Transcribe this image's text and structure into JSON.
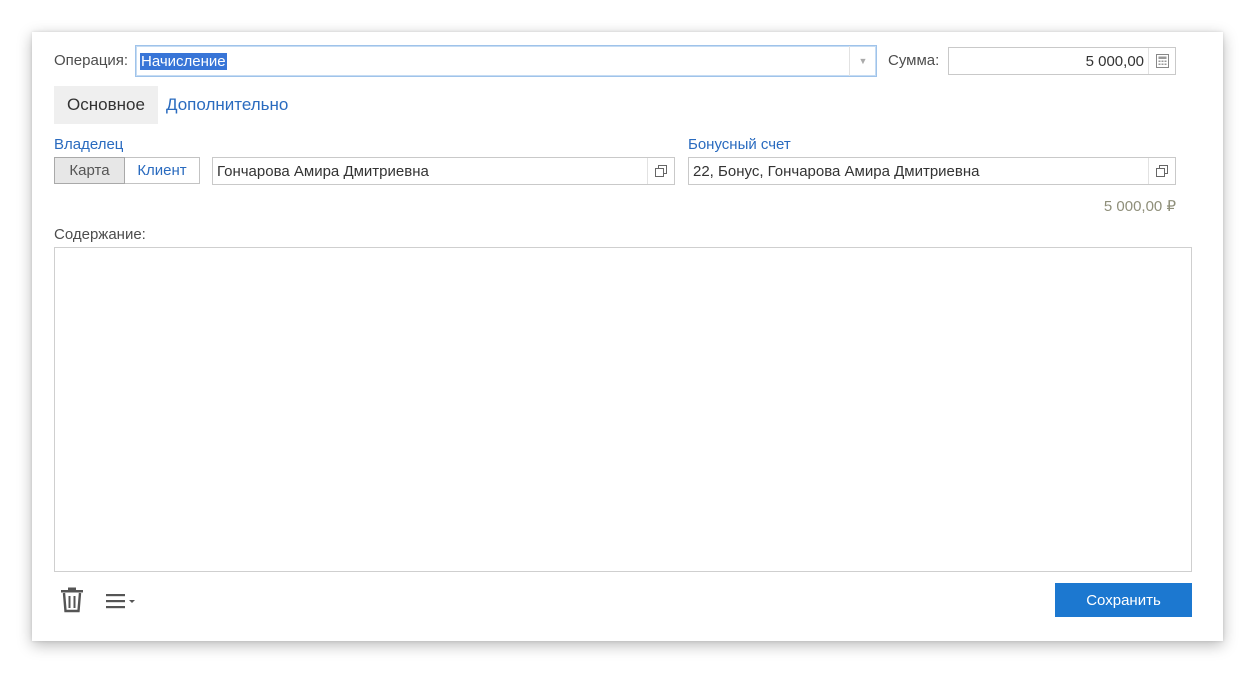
{
  "form": {
    "operation_label": "Операция:",
    "operation_value": "Начисление",
    "sum_label": "Сумма:",
    "sum_value": "5 000,00",
    "tabs": [
      {
        "label": "Основное"
      },
      {
        "label": "Дополнительно"
      }
    ],
    "owner": {
      "label": "Владелец",
      "toggle": [
        "Карта",
        "Клиент"
      ],
      "value": "Гончарова Амира Дмитриевна"
    },
    "bonus_account": {
      "label": "Бонусный счет",
      "value": "22, Бонус, Гончарова Амира Дмитриевна",
      "balance": "5 000,00 ₽"
    },
    "content_label": "Содержание:",
    "content_value": ""
  },
  "toolbar": {
    "save_label": "Сохранить"
  },
  "icons": [
    "chevron-down-icon",
    "calculator-icon",
    "open-icon",
    "trash-icon",
    "menu-icon"
  ],
  "colors": {
    "accent": "#1c78d0",
    "link": "#2a6bbf",
    "selection": "#3875d7"
  }
}
